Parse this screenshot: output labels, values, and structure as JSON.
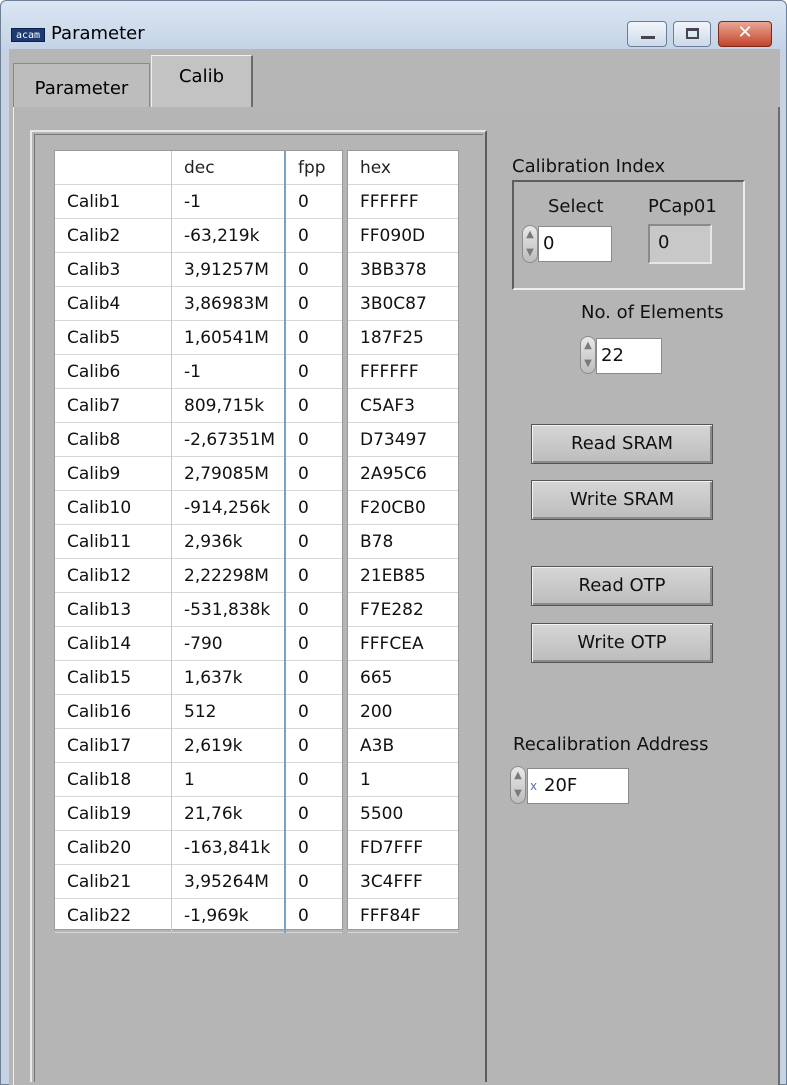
{
  "window": {
    "icon_text": "acam",
    "title": "Parameter"
  },
  "tabs": [
    {
      "label": "Parameter"
    },
    {
      "label": "Calib"
    }
  ],
  "calib_table": {
    "headers": {
      "name": "",
      "dec": "dec",
      "fpp": "fpp",
      "hex": "hex"
    },
    "rows": [
      {
        "name": "Calib1",
        "dec": "-1",
        "fpp": "0",
        "hex": "FFFFFF"
      },
      {
        "name": "Calib2",
        "dec": "-63,219k",
        "fpp": "0",
        "hex": "FF090D"
      },
      {
        "name": "Calib3",
        "dec": "3,91257M",
        "fpp": "0",
        "hex": "3BB378"
      },
      {
        "name": "Calib4",
        "dec": "3,86983M",
        "fpp": "0",
        "hex": "3B0C87"
      },
      {
        "name": "Calib5",
        "dec": "1,60541M",
        "fpp": "0",
        "hex": "187F25"
      },
      {
        "name": "Calib6",
        "dec": "-1",
        "fpp": "0",
        "hex": "FFFFFF"
      },
      {
        "name": "Calib7",
        "dec": "809,715k",
        "fpp": "0",
        "hex": "C5AF3"
      },
      {
        "name": "Calib8",
        "dec": "-2,67351M",
        "fpp": "0",
        "hex": "D73497"
      },
      {
        "name": "Calib9",
        "dec": "2,79085M",
        "fpp": "0",
        "hex": "2A95C6"
      },
      {
        "name": "Calib10",
        "dec": "-914,256k",
        "fpp": "0",
        "hex": "F20CB0"
      },
      {
        "name": "Calib11",
        "dec": "2,936k",
        "fpp": "0",
        "hex": "B78"
      },
      {
        "name": "Calib12",
        "dec": "2,22298M",
        "fpp": "0",
        "hex": "21EB85"
      },
      {
        "name": "Calib13",
        "dec": "-531,838k",
        "fpp": "0",
        "hex": "F7E282"
      },
      {
        "name": "Calib14",
        "dec": "-790",
        "fpp": "0",
        "hex": "FFFCEA"
      },
      {
        "name": "Calib15",
        "dec": "1,637k",
        "fpp": "0",
        "hex": "665"
      },
      {
        "name": "Calib16",
        "dec": "512",
        "fpp": "0",
        "hex": "200"
      },
      {
        "name": "Calib17",
        "dec": "2,619k",
        "fpp": "0",
        "hex": "A3B"
      },
      {
        "name": "Calib18",
        "dec": "1",
        "fpp": "0",
        "hex": "1"
      },
      {
        "name": "Calib19",
        "dec": "21,76k",
        "fpp": "0",
        "hex": "5500"
      },
      {
        "name": "Calib20",
        "dec": "-163,841k",
        "fpp": "0",
        "hex": "FD7FFF"
      },
      {
        "name": "Calib21",
        "dec": "3,95264M",
        "fpp": "0",
        "hex": "3C4FFF"
      },
      {
        "name": "Calib22",
        "dec": "-1,969k",
        "fpp": "0",
        "hex": "FFF84F"
      }
    ]
  },
  "calibration_index": {
    "title": "Calibration Index",
    "select_label": "Select",
    "select_value": "0",
    "pcap_label": "PCap01",
    "pcap_value": "0"
  },
  "elements": {
    "label": "No. of Elements",
    "value": "22"
  },
  "buttons": {
    "read_sram": "Read SRAM",
    "write_sram": "Write SRAM",
    "read_otp": "Read OTP",
    "write_otp": "Write OTP"
  },
  "recalibration": {
    "label": "Recalibration Address",
    "radix": "x",
    "value": "20F"
  },
  "icons": {
    "close_glyph": "✕",
    "spin_up": "▲",
    "spin_down": "▼"
  }
}
